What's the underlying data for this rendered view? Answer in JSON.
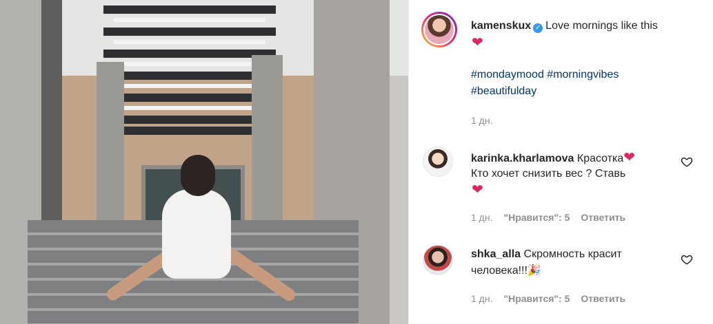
{
  "post": {
    "username": "kamenskux",
    "caption": "Love mornings like this",
    "caption_emoji": "❤",
    "hashtags_line1": "#mondaymood #morningvibes",
    "hashtags_line2": "#beautifulday",
    "time": "1 дн."
  },
  "comments": [
    {
      "username": "karinka.kharlamova",
      "text_part1": "Красотка",
      "emoji1": "❤",
      "text_line2": "Кто хочет снизить вес ? Ставь",
      "emoji2": "❤",
      "time": "1 дн.",
      "likes": "\"Нравится\": 5",
      "reply": "Ответить"
    },
    {
      "username": "shka_alla",
      "text_line1": "Скромность красит",
      "text_line2": "человека!!!",
      "emoji": "🎉",
      "time": "1 дн.",
      "likes": "\"Нравится\": 5",
      "reply": "Ответить"
    }
  ],
  "icons": {
    "verified": "verified-badge-icon",
    "like": "heart-outline-icon"
  },
  "colors": {
    "hashtag": "#00376b",
    "verified": "#3897f0",
    "heart": "#e0245e",
    "meta": "#8e8e8e"
  }
}
